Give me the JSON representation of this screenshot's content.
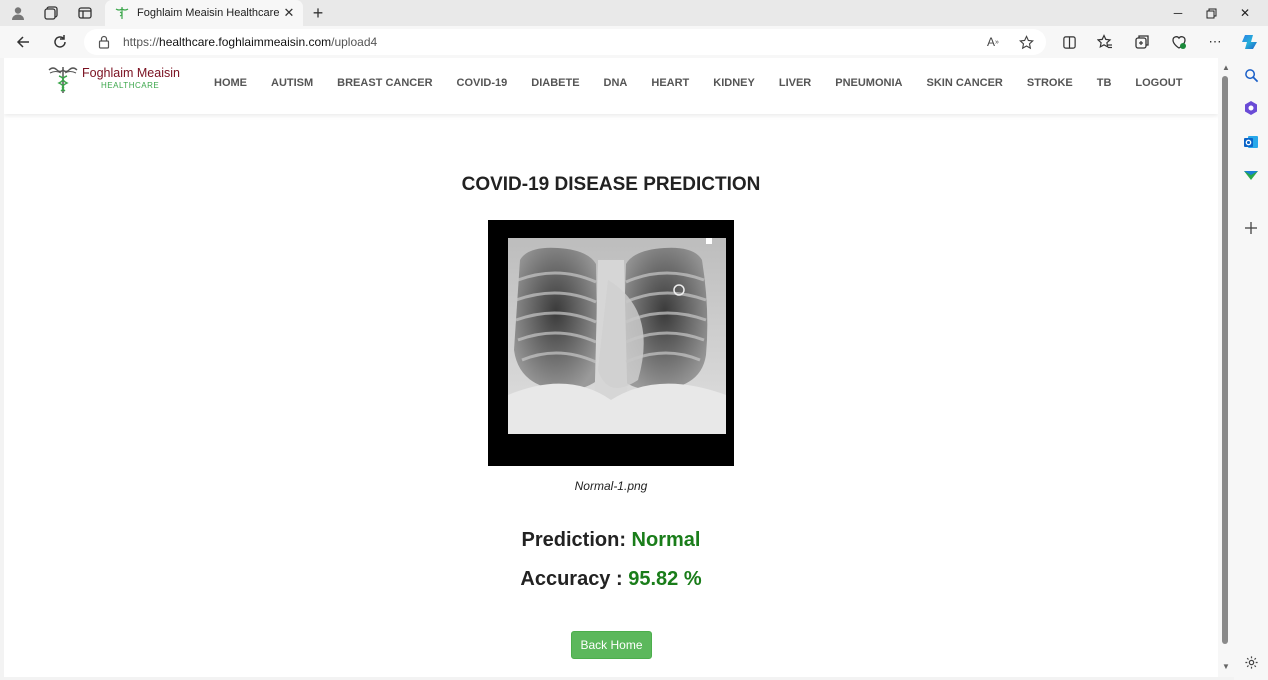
{
  "browser": {
    "tab_title": "Foghlaim Meaisin Healthcare",
    "url_prefix": "https://",
    "url_host": "healthcare.foghlaimmeaisin.com",
    "url_path": "/upload4",
    "icons": {
      "profile": "profile-icon",
      "workspaces": "workspaces-icon",
      "tab_actions": "tab-actions-icon",
      "back": "back-arrow-icon",
      "refresh": "refresh-icon",
      "lock": "lock-icon",
      "read_aloud": "read-aloud-icon",
      "favorite": "star-icon",
      "split_screen": "split-screen-icon",
      "favorites": "favorites-icon",
      "collections": "collections-icon",
      "browser_essentials": "browser-essentials-icon",
      "more": "more-icon",
      "copilot": "copilot-icon"
    }
  },
  "site": {
    "logo_name": "Foghlaim Meaisin",
    "logo_sub": "HEALTHCARE",
    "menu": [
      "HOME",
      "AUTISM",
      "BREAST CANCER",
      "COVID-19",
      "DIABETE",
      "DNA",
      "HEART",
      "KIDNEY",
      "LIVER",
      "PNEUMONIA",
      "SKIN CANCER",
      "STROKE",
      "TB",
      "LOGOUT"
    ]
  },
  "result": {
    "title": "COVID-19 DISEASE PREDICTION",
    "filename": "Normal-1.png",
    "prediction_label": "Prediction: ",
    "prediction_value": "Normal",
    "accuracy_label": "Accuracy : ",
    "accuracy_value": "95.82 %",
    "back_button": "Back Home"
  },
  "colors": {
    "accent_green": "#5cb85c",
    "result_green": "#1a7d1a",
    "logo_red": "#7a1020"
  }
}
